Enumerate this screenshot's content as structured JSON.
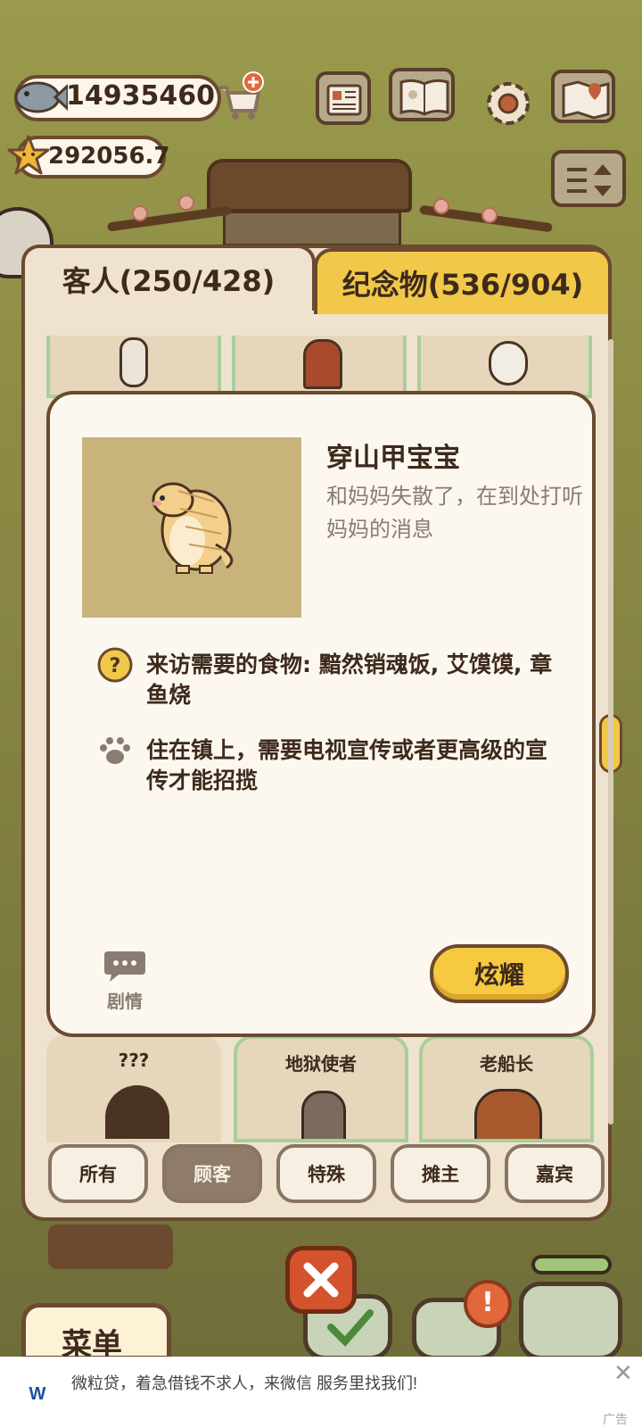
{
  "currency": {
    "fish": "14935460",
    "stars": "292056.7"
  },
  "tabs": {
    "guests": "客人(250/428)",
    "souvenirs": "纪念物(536/904)"
  },
  "dialog": {
    "name": "穿山甲宝宝",
    "description": "和妈妈失散了，在到处打听妈妈的消息",
    "food_line": "来访需要的食物: 黯然销魂饭, 艾馍馍, 章鱼烧",
    "visit_line": "住在镇上，需要电视宣传或者更高级的宣传才能招揽",
    "story_label": "剧情",
    "show_button": "炫耀"
  },
  "cards_bottom": [
    {
      "name": "???"
    },
    {
      "name": "地狱使者"
    },
    {
      "name": "老船长"
    }
  ],
  "filters": [
    "所有",
    "顾客",
    "特殊",
    "摊主",
    "嘉宾"
  ],
  "active_filter": "顾客",
  "bottom_bar": {
    "menu_label": "菜单"
  },
  "ad": {
    "title": "微粒贷，着急借钱不求人，来微信 服务里找我们!",
    "tag": "广告"
  },
  "colors": {
    "accent_yellow": "#f6c940",
    "panel_bg": "#efe3cf",
    "border_brown": "#6b4a30",
    "close_red": "#d2532c"
  }
}
